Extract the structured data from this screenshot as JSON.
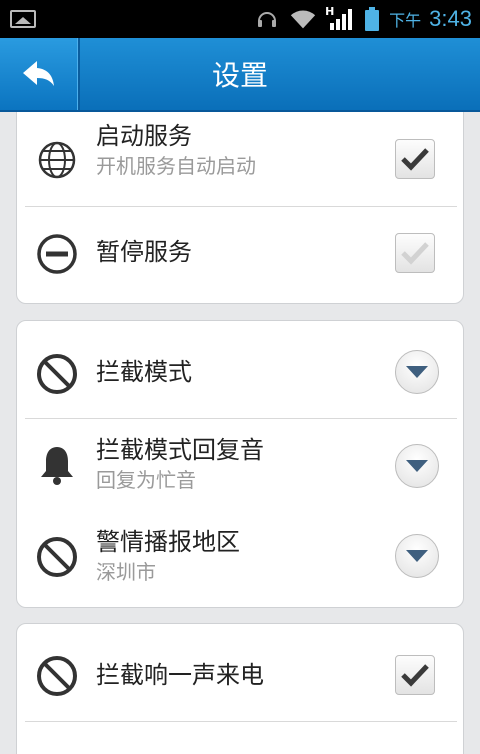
{
  "status_bar": {
    "time_prefix": "下午",
    "time": "3:43",
    "signal_label": "H",
    "icons": [
      "image-icon",
      "headset-icon",
      "wifi-icon",
      "signal-icon",
      "battery-icon"
    ]
  },
  "header": {
    "title": "设置",
    "back_icon": "back-arrow-icon"
  },
  "groups": [
    {
      "items": [
        {
          "title": "启动服务",
          "subtitle": "开机服务自动启动",
          "icon": "globe-icon",
          "control": "checkbox",
          "checked": true,
          "enabled": true
        },
        {
          "title": "暂停服务",
          "icon": "minus-circle-icon",
          "control": "checkbox",
          "checked": true,
          "enabled": false
        }
      ]
    },
    {
      "items": [
        {
          "title": "拦截模式",
          "icon": "block-icon",
          "control": "dropdown"
        },
        {
          "title": "拦截模式回复音",
          "subtitle": "回复为忙音",
          "icon": "bell-icon",
          "control": "dropdown"
        },
        {
          "title": "警情播报地区",
          "subtitle": "深圳市",
          "icon": "block-icon",
          "control": "dropdown"
        }
      ]
    },
    {
      "items": [
        {
          "title": "拦截响一声来电",
          "icon": "block-icon",
          "control": "checkbox",
          "checked": true,
          "enabled": true
        }
      ]
    }
  ],
  "colors": {
    "header_blue": "#0a6fb9",
    "status_time": "#4fb3e6",
    "check_enabled": "#3a3a3a",
    "check_disabled": "#d2d2d2"
  }
}
